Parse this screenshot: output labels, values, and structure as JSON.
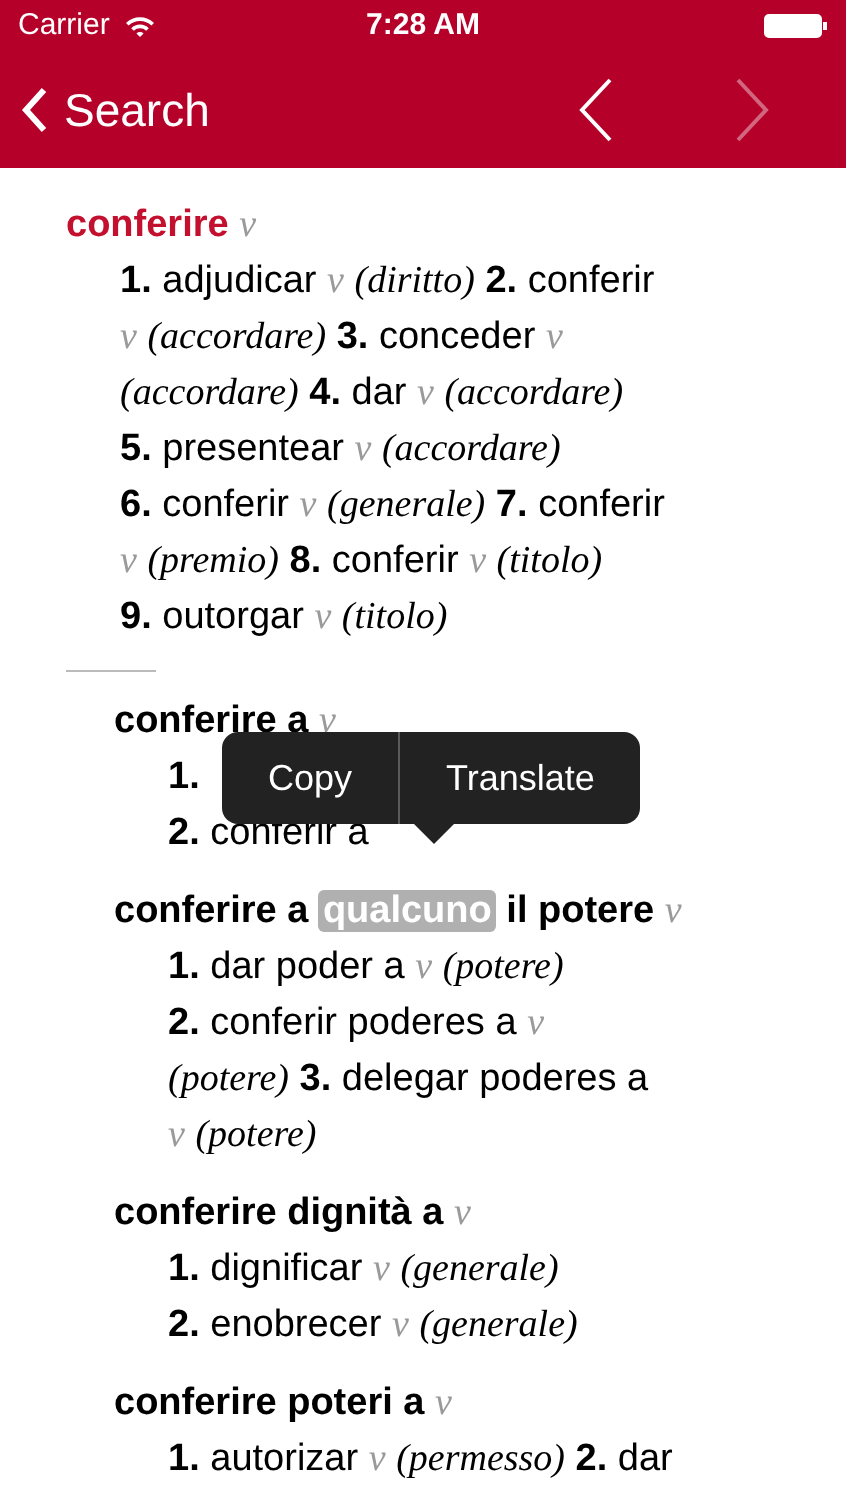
{
  "status_bar": {
    "carrier": "Carrier",
    "time": "7:28 AM"
  },
  "nav_bar": {
    "back_label": "Search",
    "prev_enabled": true,
    "next_enabled": false
  },
  "entries": [
    {
      "kind": "main",
      "headword": [
        {
          "text": "conferire",
          "selected": false
        }
      ],
      "pos": "v",
      "lines": [
        [
          {
            "kind": "num",
            "text": "1."
          },
          {
            "kind": "word",
            "text": "adjudicar"
          },
          {
            "kind": "pos",
            "text": "v"
          },
          {
            "kind": "note",
            "text": "(diritto)"
          },
          {
            "kind": "num",
            "text": "2."
          },
          {
            "kind": "word",
            "text": "conferir"
          }
        ],
        [
          {
            "kind": "pos",
            "text": "v"
          },
          {
            "kind": "note",
            "text": "(accordare)"
          },
          {
            "kind": "num",
            "text": "3."
          },
          {
            "kind": "word",
            "text": "conceder"
          },
          {
            "kind": "pos",
            "text": "v"
          }
        ],
        [
          {
            "kind": "note",
            "text": "(accordare)"
          },
          {
            "kind": "num",
            "text": "4."
          },
          {
            "kind": "word",
            "text": "dar"
          },
          {
            "kind": "pos",
            "text": "v"
          },
          {
            "kind": "note",
            "text": "(accordare)"
          }
        ],
        [
          {
            "kind": "num",
            "text": "5."
          },
          {
            "kind": "word",
            "text": "presentear"
          },
          {
            "kind": "pos",
            "text": "v"
          },
          {
            "kind": "note",
            "text": "(accordare)"
          }
        ],
        [
          {
            "kind": "num",
            "text": "6."
          },
          {
            "kind": "word",
            "text": "conferir"
          },
          {
            "kind": "pos",
            "text": "v"
          },
          {
            "kind": "note",
            "text": "(generale)"
          },
          {
            "kind": "num",
            "text": "7."
          },
          {
            "kind": "word",
            "text": "conferir"
          }
        ],
        [
          {
            "kind": "pos",
            "text": "v"
          },
          {
            "kind": "note",
            "text": "(premio)"
          },
          {
            "kind": "num",
            "text": "8."
          },
          {
            "kind": "word",
            "text": "conferir"
          },
          {
            "kind": "pos",
            "text": "v"
          },
          {
            "kind": "note",
            "text": "(titolo)"
          }
        ],
        [
          {
            "kind": "num",
            "text": "9."
          },
          {
            "kind": "word",
            "text": "outorgar"
          },
          {
            "kind": "pos",
            "text": "v"
          },
          {
            "kind": "note",
            "text": "(titolo)"
          }
        ]
      ]
    },
    {
      "kind": "sub",
      "headword": [
        {
          "text": "conferire a",
          "selected": false
        }
      ],
      "pos": "v",
      "lines": [
        [
          {
            "kind": "num",
            "text": "1."
          }
        ],
        [
          {
            "kind": "num",
            "text": "2."
          },
          {
            "kind": "word",
            "text": "conferir a"
          }
        ]
      ]
    },
    {
      "kind": "sub",
      "headword": [
        {
          "text": "conferire a",
          "selected": false
        },
        {
          "text": "qualcuno",
          "selected": true
        },
        {
          "text": "il",
          "selected": false
        },
        {
          "text": "potere",
          "selected": false
        }
      ],
      "pos": "v",
      "lines": [
        [
          {
            "kind": "num",
            "text": "1."
          },
          {
            "kind": "word",
            "text": "dar poder a"
          },
          {
            "kind": "pos",
            "text": "v"
          },
          {
            "kind": "note",
            "text": "(potere)"
          }
        ],
        [
          {
            "kind": "num",
            "text": "2."
          },
          {
            "kind": "word",
            "text": "conferir poderes a"
          },
          {
            "kind": "pos",
            "text": "v"
          }
        ],
        [
          {
            "kind": "note",
            "text": "(potere)"
          },
          {
            "kind": "num",
            "text": "3."
          },
          {
            "kind": "word",
            "text": "delegar poderes a"
          }
        ],
        [
          {
            "kind": "pos",
            "text": "v"
          },
          {
            "kind": "note",
            "text": "(potere)"
          }
        ]
      ]
    },
    {
      "kind": "sub",
      "headword": [
        {
          "text": "conferire dignità a",
          "selected": false
        }
      ],
      "pos": "v",
      "lines": [
        [
          {
            "kind": "num",
            "text": "1."
          },
          {
            "kind": "word",
            "text": "dignificar"
          },
          {
            "kind": "pos",
            "text": "v"
          },
          {
            "kind": "note",
            "text": "(generale)"
          }
        ],
        [
          {
            "kind": "num",
            "text": "2."
          },
          {
            "kind": "word",
            "text": "enobrecer"
          },
          {
            "kind": "pos",
            "text": "v"
          },
          {
            "kind": "note",
            "text": "(generale)"
          }
        ]
      ]
    },
    {
      "kind": "sub",
      "headword": [
        {
          "text": "conferire poteri a",
          "selected": false
        }
      ],
      "pos": "v",
      "lines": [
        [
          {
            "kind": "num",
            "text": "1."
          },
          {
            "kind": "word",
            "text": "autorizar"
          },
          {
            "kind": "pos",
            "text": "v"
          },
          {
            "kind": "note",
            "text": "(permesso)"
          },
          {
            "kind": "num",
            "text": "2."
          },
          {
            "kind": "word",
            "text": "dar"
          }
        ]
      ]
    }
  ],
  "popup": {
    "items": [
      "Copy",
      "Translate"
    ]
  }
}
